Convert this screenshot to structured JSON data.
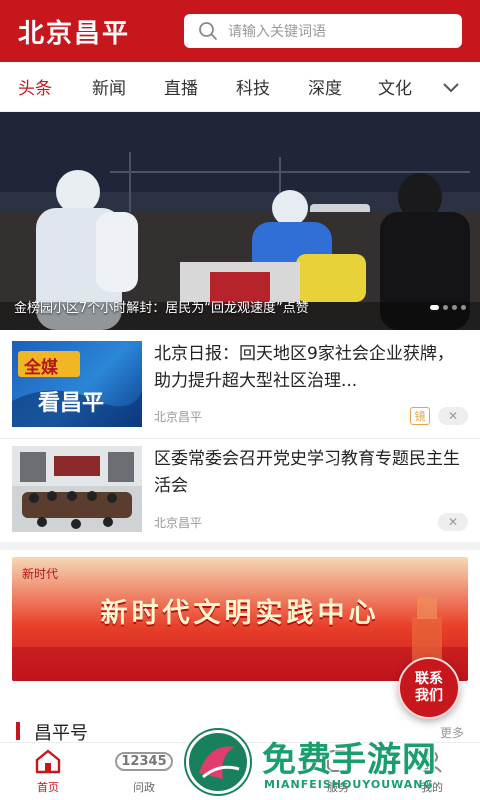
{
  "header": {
    "logo": "北京昌平",
    "search_placeholder": "请输入关键词语"
  },
  "tabs": [
    "头条",
    "新闻",
    "直播",
    "科技",
    "深度",
    "文化"
  ],
  "banner": {
    "caption": "金榜园小区7个小时解封：居民为“回龙观速度”点赞",
    "page_count": 4,
    "active_page": 1
  },
  "news": [
    {
      "thumb_text_top": "全媒",
      "thumb_text_bottom": "看昌平",
      "title": "北京日报：回天地区9家社会企业获牌，助力提升超大型社区治理...",
      "source": "北京昌平",
      "badge": "镜"
    },
    {
      "title": "区委常委会召开党史学习教育专题民主生活会",
      "source": "北京昌平"
    }
  ],
  "promo": {
    "text": "新时代文明实践中心",
    "seal": "新时代"
  },
  "contact_fab": {
    "line1": "联系",
    "line2": "我们"
  },
  "section": {
    "title": "昌平号",
    "more": "更多"
  },
  "bottom_nav": [
    {
      "label": "首页",
      "icon": "home-icon"
    },
    {
      "label": "问政",
      "icon": "hotline-12345-icon",
      "icon_text": "12345"
    },
    {
      "label": "服务",
      "icon": "service-icon"
    },
    {
      "label": "我的",
      "icon": "user-icon"
    }
  ],
  "watermark": {
    "title": "免费手游网",
    "subtitle": "MIANFEISHOUYOUWANG"
  },
  "colors": {
    "brand_red": "#c8161d",
    "watermark_green": "#1a9e6e"
  }
}
